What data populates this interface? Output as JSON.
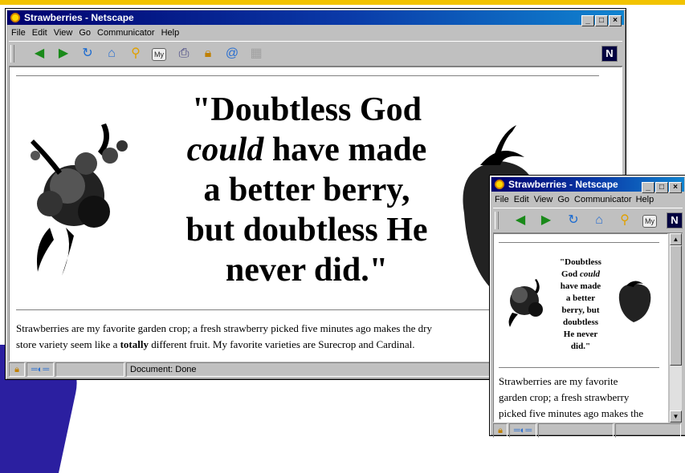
{
  "main_window": {
    "title": "Strawberries - Netscape",
    "menu": [
      "File",
      "Edit",
      "View",
      "Go",
      "Communicator",
      "Help"
    ],
    "quote_lines": [
      "\"Doubtless God",
      "could",
      " have made",
      "a better berry,",
      "but doubtless He",
      "never did.\""
    ],
    "para_part1": "Strawberries are my favorite garden crop; a fresh strawberry picked five minutes ago makes the dry",
    "para_part2": "store variety seem like a ",
    "para_bold": "totally",
    "para_part3": " different fruit. My favorite varieties are Surecrop and Cardinal.",
    "status": "Document: Done"
  },
  "small_window": {
    "title": "Strawberries - Netscape",
    "menu": [
      "File",
      "Edit",
      "View",
      "Go",
      "Communicator",
      "Help"
    ],
    "quote_lines": [
      "\"Doubtless",
      "God ",
      "could",
      "have made",
      "a better",
      "berry, but",
      "doubtless",
      "He never",
      "did.\""
    ],
    "para_lines": [
      "Strawberries are my favorite",
      "garden crop; a fresh strawberry",
      "picked five minutes ago makes the"
    ]
  },
  "icons": [
    "back-icon",
    "forward-icon",
    "reload-icon",
    "home-icon",
    "search-icon",
    "my-netscape-icon",
    "print-icon",
    "security-icon",
    "shop-icon",
    "stop-icon",
    "netscape-n-icon"
  ],
  "colors": {
    "titlebar": "#00006e",
    "accent_yellow": "#f2c300",
    "swoosh": "#2b1fa0",
    "chrome": "#c0c0c0"
  }
}
